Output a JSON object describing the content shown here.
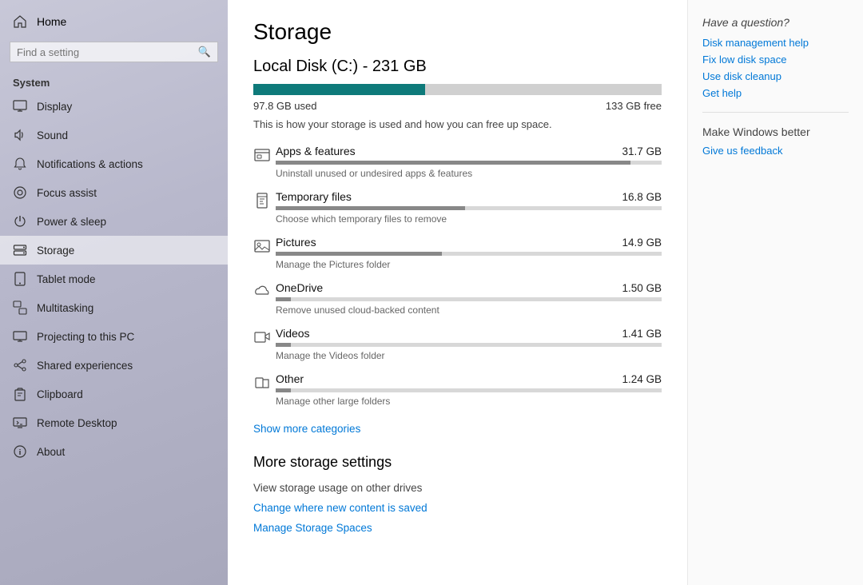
{
  "sidebar": {
    "home_label": "Home",
    "search_placeholder": "Find a setting",
    "section_title": "System",
    "items": [
      {
        "id": "display",
        "label": "Display",
        "icon": "display"
      },
      {
        "id": "sound",
        "label": "Sound",
        "icon": "sound"
      },
      {
        "id": "notifications",
        "label": "Notifications & actions",
        "icon": "notifications"
      },
      {
        "id": "focus",
        "label": "Focus assist",
        "icon": "focus"
      },
      {
        "id": "power",
        "label": "Power & sleep",
        "icon": "power"
      },
      {
        "id": "storage",
        "label": "Storage",
        "icon": "storage",
        "active": true
      },
      {
        "id": "tablet",
        "label": "Tablet mode",
        "icon": "tablet"
      },
      {
        "id": "multitasking",
        "label": "Multitasking",
        "icon": "multitasking"
      },
      {
        "id": "projecting",
        "label": "Projecting to this PC",
        "icon": "projecting"
      },
      {
        "id": "shared",
        "label": "Shared experiences",
        "icon": "shared"
      },
      {
        "id": "clipboard",
        "label": "Clipboard",
        "icon": "clipboard"
      },
      {
        "id": "remote",
        "label": "Remote Desktop",
        "icon": "remote"
      },
      {
        "id": "about",
        "label": "About",
        "icon": "about"
      }
    ]
  },
  "main": {
    "page_title": "Storage",
    "disk_title": "Local Disk (C:) - 231 GB",
    "used_label": "97.8 GB used",
    "free_label": "133 GB free",
    "used_pct": 42,
    "disk_desc": "This is how your storage is used and how you can free up space.",
    "storage_items": [
      {
        "id": "apps",
        "name": "Apps & features",
        "size": "31.7 GB",
        "desc": "Uninstall unused or undesired apps & features",
        "pct": 92,
        "icon": "apps"
      },
      {
        "id": "temp",
        "name": "Temporary files",
        "size": "16.8 GB",
        "desc": "Choose which temporary files to remove",
        "pct": 49,
        "icon": "temp"
      },
      {
        "id": "pictures",
        "name": "Pictures",
        "size": "14.9 GB",
        "desc": "Manage the Pictures folder",
        "pct": 43,
        "icon": "pictures"
      },
      {
        "id": "onedrive",
        "name": "OneDrive",
        "size": "1.50 GB",
        "desc": "Remove unused cloud-backed content",
        "pct": 4,
        "icon": "onedrive"
      },
      {
        "id": "videos",
        "name": "Videos",
        "size": "1.41 GB",
        "desc": "Manage the Videos folder",
        "pct": 4,
        "icon": "videos"
      },
      {
        "id": "other",
        "name": "Other",
        "size": "1.24 GB",
        "desc": "Manage other large folders",
        "pct": 4,
        "icon": "other"
      }
    ],
    "show_more_label": "Show more categories",
    "more_settings_title": "More storage settings",
    "view_other_drives": "View storage usage on other drives",
    "change_content_link": "Change where new content is saved",
    "manage_spaces_link": "Manage Storage Spaces"
  },
  "right_panel": {
    "question": "Have a question?",
    "links": [
      "Disk management help",
      "Fix low disk space",
      "Use disk cleanup",
      "Get help"
    ],
    "make_better": "Make Windows better",
    "feedback_link": "Give us feedback"
  }
}
